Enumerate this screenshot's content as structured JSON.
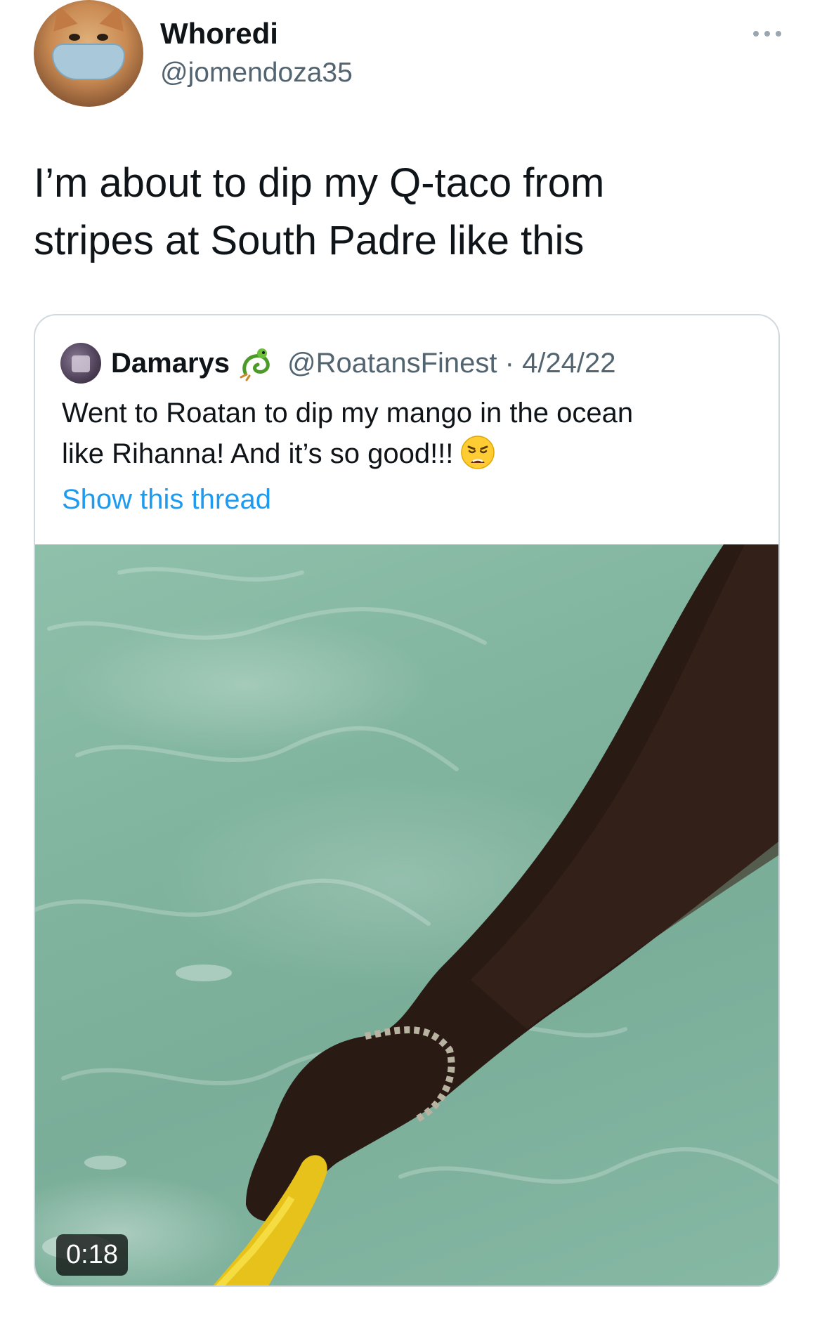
{
  "tweet": {
    "display_name": "Whoredi",
    "handle": "@jomendoza35",
    "more_icon": "more-horizontal-icon",
    "text_line1": "I’m about to dip my Q-taco from",
    "text_line2": "stripes at South Padre like this"
  },
  "quote": {
    "display_name": "Damarys",
    "name_emoji_icon": "dragon-icon",
    "handle_date": "@RoatansFinest · 4/24/22",
    "text_line1": "Went to Roatan to dip my mango in the ocean",
    "text_line2": "like Rihanna! And it’s so good!!!",
    "text_emoji_icon": "weary-face-icon",
    "thread_link": "Show this thread",
    "video_duration": "0:18"
  },
  "colors": {
    "text_primary": "#0f1419",
    "text_secondary": "#536471",
    "link": "#1d9bf0",
    "border": "#cfd9de"
  }
}
